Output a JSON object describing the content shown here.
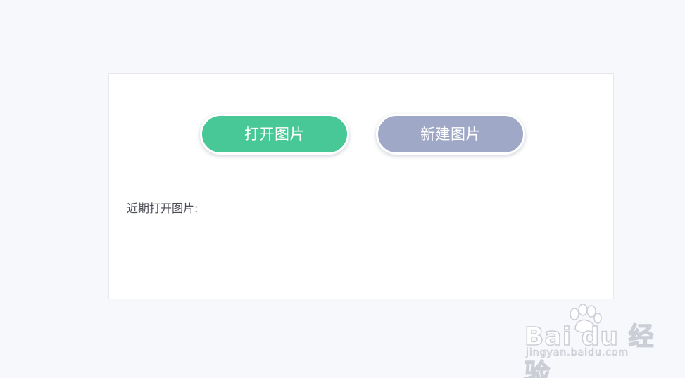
{
  "actions": {
    "open_image_label": "打开图片",
    "new_image_label": "新建图片"
  },
  "recent": {
    "label": "近期打开图片:"
  },
  "watermark": {
    "brand": "Bai du 经验",
    "url": "jingyan.baidu.com"
  },
  "colors": {
    "page_background": "#f7f8fc",
    "open_button": "#47c896",
    "new_button": "#9fa8c6"
  }
}
